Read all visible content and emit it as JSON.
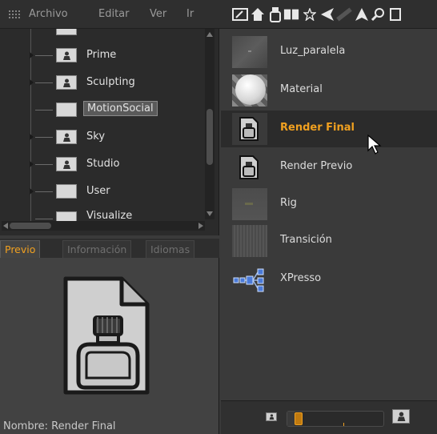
{
  "menubar": {
    "items": [
      "Archivo",
      "Editar",
      "Ver",
      "Ir"
    ]
  },
  "toolbar": {
    "icons": [
      "edit-icon",
      "home-icon",
      "render-bottle-icon",
      "book-icon",
      "star-icon",
      "back-arrow-icon",
      "forward-arrow-icon",
      "up-arrow-icon",
      "search-icon"
    ]
  },
  "tree": {
    "items": [
      {
        "label": "Prime",
        "selected": false
      },
      {
        "label": "Sculpting",
        "selected": false
      },
      {
        "label": "MotionSocial",
        "selected": true
      },
      {
        "label": "Sky",
        "selected": false
      },
      {
        "label": "Studio",
        "selected": false
      },
      {
        "label": "User",
        "selected": false
      },
      {
        "label": "Visualize",
        "selected": false
      }
    ]
  },
  "tabs": [
    {
      "label": "Previo",
      "active": true
    },
    {
      "label": "Información",
      "active": false
    },
    {
      "label": "Idiomas",
      "active": false
    }
  ],
  "preview": {
    "name_label": "Nombre: Render Final"
  },
  "list": {
    "items": [
      {
        "label": "Luz_paralela",
        "icon": "light-thumbnail",
        "selected": false
      },
      {
        "label": "Material",
        "icon": "material-sphere-thumbnail",
        "selected": false
      },
      {
        "label": "Render Final",
        "icon": "render-bottle-icon",
        "selected": true
      },
      {
        "label": "Render Previo",
        "icon": "render-bottle-icon",
        "selected": false
      },
      {
        "label": "Rig",
        "icon": "rig-thumbnail",
        "selected": false
      },
      {
        "label": "Transición",
        "icon": "transition-thumbnail",
        "selected": false
      },
      {
        "label": "XPresso",
        "icon": "xpresso-node-icon",
        "selected": false
      }
    ]
  },
  "zoom": {
    "level": 0.08
  },
  "colors": {
    "accent": "#f0a020",
    "panel": "#3a3a3a",
    "selected_row": "#2b2b2b"
  }
}
